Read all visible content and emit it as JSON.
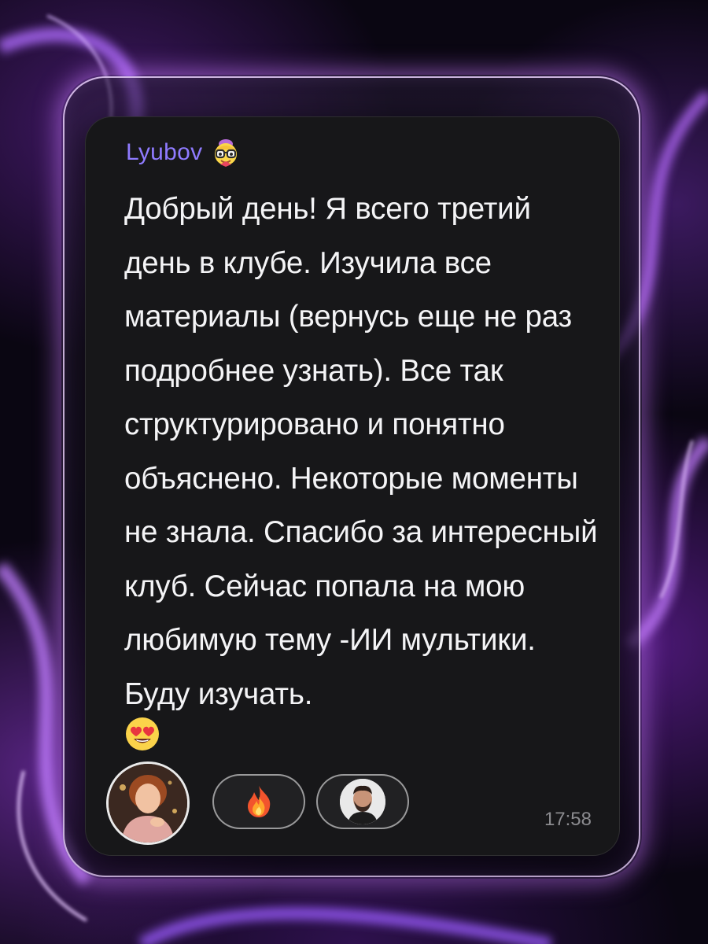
{
  "message": {
    "author": "Lyubov",
    "author_icon": "nerd-face-emoji-icon",
    "text": "Добрый день! Я всего третий день в клубе. Изучила все материалы (вернусь еще не раз подробнее узнать). Все так структурировано и понятно объяснено. Некоторые моменты не знала. Спасибо за интересный клуб. Сейчас попала на мою любимую тему -ИИ мультики. Буду изучать.",
    "trailing_emoji": "heart-eyes-emoji-icon",
    "timestamp": "17:58"
  },
  "reactions": [
    {
      "type": "avatar",
      "icon": "woman-avatar"
    },
    {
      "type": "emoji",
      "icon": "fire-emoji-icon"
    },
    {
      "type": "avatar",
      "icon": "man-avatar"
    }
  ],
  "colors": {
    "author": "#8f7bff",
    "message_text": "#f4f4f6",
    "timestamp": "#8c8c90",
    "card": "#171719",
    "frame_border": "#ecd2ff",
    "background_glow": "#8a3ee0"
  }
}
